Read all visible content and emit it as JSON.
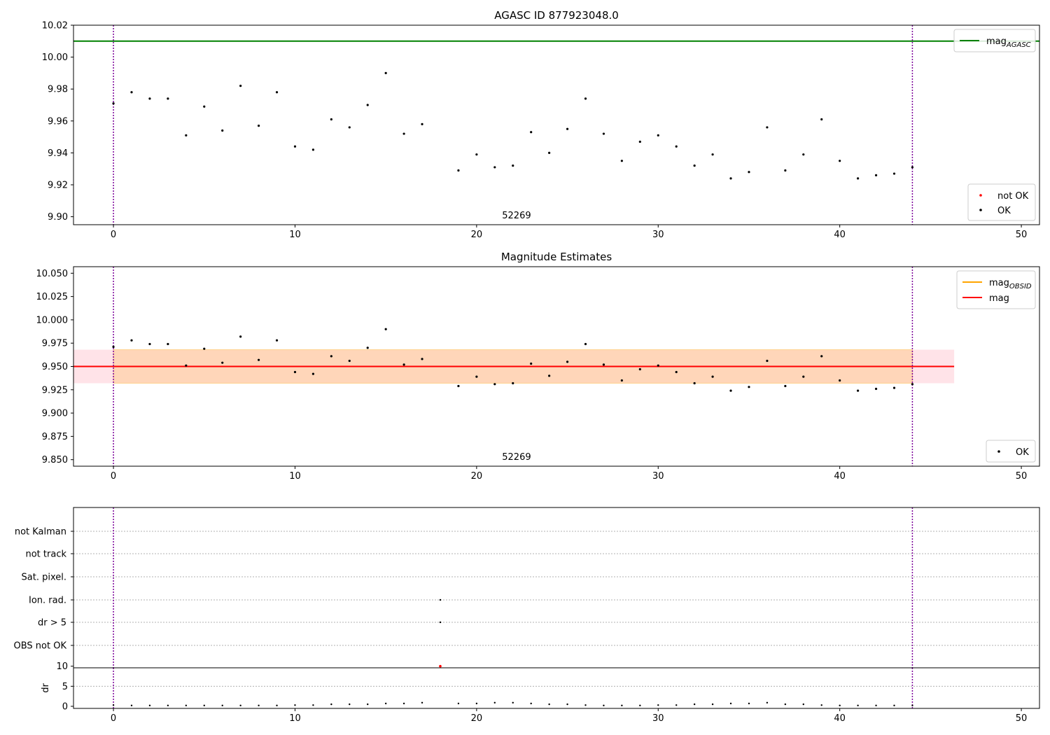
{
  "chart_data": [
    {
      "type": "scatter",
      "title": "AGASC ID 877923048.0",
      "xlim": [
        -2.2,
        51.0
      ],
      "ylim": [
        9.895,
        10.02
      ],
      "xticks": [
        "0",
        "10",
        "20",
        "30",
        "40",
        "50"
      ],
      "yticks": [
        "9.90",
        "9.92",
        "9.94",
        "9.96",
        "9.98",
        "10.00",
        "10.02"
      ],
      "obsid_label": "52269",
      "obs_bounds": [
        0,
        44
      ],
      "mag_agasc": 10.01,
      "line_legend": [
        {
          "name": "mag",
          "sub": "AGASC",
          "color": "#008000"
        }
      ],
      "point_legend": [
        {
          "name": "not OK",
          "color": "#ff0000"
        },
        {
          "name": "OK",
          "color": "#000000"
        }
      ],
      "series": [
        {
          "name": "OK",
          "color": "#000000",
          "x": [
            0,
            1,
            2,
            3,
            4,
            5,
            6,
            7,
            8,
            9,
            10,
            11,
            12,
            13,
            14,
            15,
            16,
            17,
            19,
            20,
            21,
            22,
            23,
            24,
            25,
            26,
            27,
            28,
            29,
            30,
            31,
            32,
            33,
            34,
            35,
            36,
            37,
            38,
            39,
            40,
            41,
            42,
            43,
            44
          ],
          "y": [
            9.971,
            9.978,
            9.974,
            9.974,
            9.951,
            9.969,
            9.954,
            9.982,
            9.957,
            9.978,
            9.944,
            9.942,
            9.961,
            9.956,
            9.97,
            9.99,
            9.952,
            9.958,
            9.929,
            9.939,
            9.931,
            9.932,
            9.953,
            9.94,
            9.955,
            9.974,
            9.952,
            9.935,
            9.947,
            9.951,
            9.944,
            9.932,
            9.939,
            9.924,
            9.928,
            9.956,
            9.929,
            9.939,
            9.961,
            9.935,
            9.924,
            9.926,
            9.927,
            9.931
          ]
        }
      ]
    },
    {
      "type": "scatter",
      "title": "Magnitude Estimates",
      "xlim": [
        -2.2,
        51.0
      ],
      "ylim": [
        9.843,
        10.057
      ],
      "xticks": [
        "0",
        "10",
        "20",
        "30",
        "40",
        "50"
      ],
      "yticks": [
        "9.850",
        "9.875",
        "9.900",
        "9.925",
        "9.950",
        "9.975",
        "10.000",
        "10.025",
        "10.050"
      ],
      "obsid_label": "52269",
      "obs_bounds": [
        0,
        44
      ],
      "mag": 9.95,
      "mag_band": [
        9.932,
        9.968
      ],
      "band_xlim": [
        -2.2,
        46.3
      ],
      "line_legend": [
        {
          "name": "mag",
          "sub": "OBSID",
          "color": "#ffa500"
        },
        {
          "name": "mag",
          "sub": "",
          "color": "#ff0000"
        }
      ],
      "point_legend": [
        {
          "name": "OK",
          "color": "#000000"
        }
      ],
      "series": [
        {
          "name": "OK",
          "color": "#000000",
          "x": [
            0,
            1,
            2,
            3,
            4,
            5,
            6,
            7,
            8,
            9,
            10,
            11,
            12,
            13,
            14,
            15,
            16,
            17,
            19,
            20,
            21,
            22,
            23,
            24,
            25,
            26,
            27,
            28,
            29,
            30,
            31,
            32,
            33,
            34,
            35,
            36,
            37,
            38,
            39,
            40,
            41,
            42,
            43,
            44
          ],
          "y": [
            9.971,
            9.978,
            9.974,
            9.974,
            9.951,
            9.969,
            9.954,
            9.982,
            9.957,
            9.978,
            9.944,
            9.942,
            9.961,
            9.956,
            9.97,
            9.99,
            9.952,
            9.958,
            9.929,
            9.939,
            9.931,
            9.932,
            9.953,
            9.94,
            9.955,
            9.974,
            9.952,
            9.935,
            9.947,
            9.951,
            9.944,
            9.932,
            9.939,
            9.924,
            9.928,
            9.956,
            9.929,
            9.939,
            9.961,
            9.935,
            9.924,
            9.926,
            9.927,
            9.931
          ]
        }
      ]
    },
    {
      "type": "scatter",
      "title": "",
      "xlim": [
        -2.2,
        51.0
      ],
      "xticks": [
        "0",
        "10",
        "20",
        "30",
        "40",
        "50"
      ],
      "flag_labels": [
        "not Kalman",
        "not track",
        "Sat. pixel.",
        "Ion. rad.",
        "dr > 5",
        "OBS not OK"
      ],
      "flags": [
        {
          "flag": "Ion. rad.",
          "x": [
            18
          ]
        },
        {
          "flag": "dr > 5",
          "x": [
            18
          ]
        }
      ],
      "obs_bounds": [
        0,
        44
      ],
      "dr": {
        "ylabel": "dr",
        "ylim": [
          0,
          11
        ],
        "yticks": [
          "0",
          "5",
          "10"
        ],
        "x": [
          0,
          1,
          2,
          3,
          4,
          5,
          6,
          7,
          8,
          9,
          10,
          11,
          12,
          13,
          14,
          15,
          16,
          17,
          18,
          19,
          20,
          21,
          22,
          23,
          24,
          25,
          26,
          27,
          28,
          29,
          30,
          31,
          32,
          33,
          34,
          35,
          36,
          37,
          38,
          39,
          40,
          41,
          42,
          43,
          44
        ],
        "y": [
          0.3,
          0.2,
          0.2,
          0.2,
          0.2,
          0.2,
          0.2,
          0.2,
          0.2,
          0.2,
          0.3,
          0.3,
          0.5,
          0.5,
          0.5,
          0.7,
          0.7,
          0.9,
          10.0,
          0.7,
          0.7,
          0.9,
          0.9,
          0.7,
          0.5,
          0.5,
          0.3,
          0.2,
          0.2,
          0.2,
          0.3,
          0.3,
          0.5,
          0.5,
          0.7,
          0.7,
          0.9,
          0.5,
          0.5,
          0.3,
          0.2,
          0.2,
          0.2,
          0.2,
          0.2
        ],
        "outlier_x": [
          18
        ]
      }
    }
  ]
}
